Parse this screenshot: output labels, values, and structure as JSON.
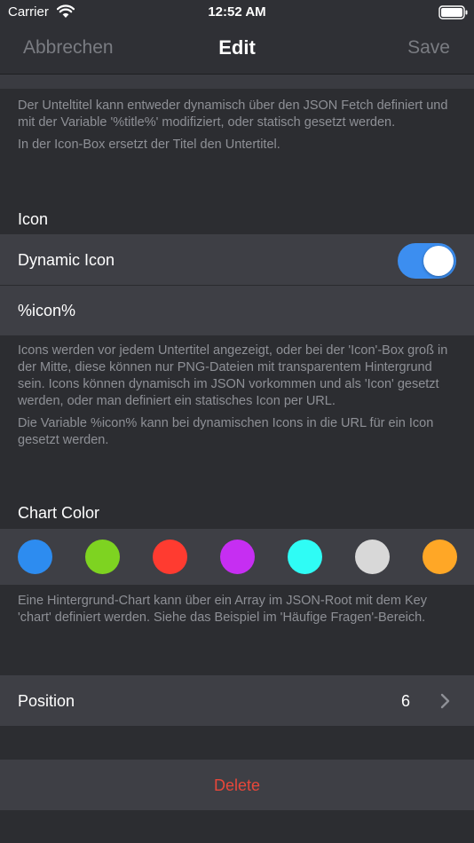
{
  "status_bar": {
    "carrier": "Carrier",
    "time": "12:52 AM",
    "icons": [
      "wifi-icon",
      "battery-icon"
    ]
  },
  "nav": {
    "cancel_label": "Abbrechen",
    "title": "Edit",
    "save_label": "Save"
  },
  "subtitle_footer": {
    "line1": "Der Unteltitel kann entweder dynamisch über den JSON Fetch definiert und mit der Variable '%title%' modifiziert, oder statisch gesetzt werden.",
    "line2": "In der Icon-Box ersetzt der Titel den Untertitel."
  },
  "icon_section": {
    "header": "Icon",
    "dynamic_icon_label": "Dynamic Icon",
    "dynamic_icon_on": true,
    "icon_value": "%icon%",
    "footer1": "Icons werden vor jedem Untertitel angezeigt, oder bei der 'Icon'-Box groß in der Mitte, diese können nur PNG-Dateien mit transparentem Hintergrund sein. Icons können dynamisch im JSON vorkommen und als 'Icon' gesetzt werden, oder man definiert ein statisches Icon per URL.",
    "footer2": "Die Variable %icon% kann bei dynamischen Icons in die URL für ein Icon gesetzt werden."
  },
  "chart_color_section": {
    "header": "Chart Color",
    "colors": [
      "#2d8cf0",
      "#7ed321",
      "#ff3b30",
      "#c62ef2",
      "#2ffcf5",
      "#d8d8d8",
      "#ffa726"
    ],
    "footer": "Eine Hintergrund-Chart kann über ein Array im JSON-Root mit dem Key 'chart' definiert werden. Siehe das Beispiel im 'Häufige Fragen'-Bereich."
  },
  "position_row": {
    "label": "Position",
    "value": "6"
  },
  "delete_button": {
    "label": "Delete"
  },
  "theme": {
    "background": "#2c2d31",
    "cell": "#3e3f45",
    "accent": "#3c8ef0",
    "destructive": "#e8473a"
  }
}
